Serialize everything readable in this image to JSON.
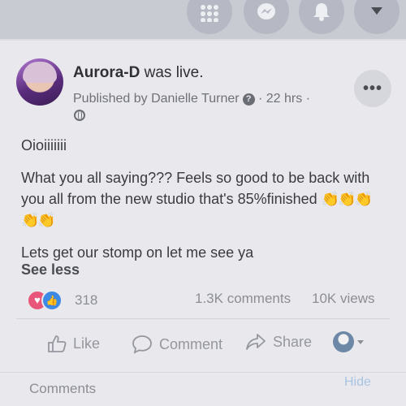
{
  "post": {
    "author": "Aurora-D",
    "action_text": " was live.",
    "published_prefix": "Published by ",
    "publisher": "Danielle Turner",
    "time": " · 22 hrs ·",
    "line1": "Oioiiiiiii",
    "line2": "What you all saying??? Feels so good to be back with you all from the new studio that's 85%finished",
    "emojis": "👏👏👏👏👏",
    "line3": "Lets get our stomp on let me see ya",
    "see_less": "See less"
  },
  "stats": {
    "reactions": "318",
    "comments": "1.3K comments",
    "views": "10K views"
  },
  "actions": {
    "like": "Like",
    "comment": "Comment",
    "share": "Share"
  },
  "comments_section": {
    "label": "Comments",
    "hide": "Hide"
  },
  "colors": {
    "love": "#e8577a",
    "like": "#3d89e6",
    "notification_badge": "#e0504c"
  },
  "icons": [
    "menu-grid-icon",
    "messenger-icon",
    "bell-icon",
    "caret-down-icon",
    "globe-icon",
    "info-icon",
    "more-icon",
    "like-thumb-icon",
    "comment-bubble-icon",
    "share-arrow-icon"
  ]
}
